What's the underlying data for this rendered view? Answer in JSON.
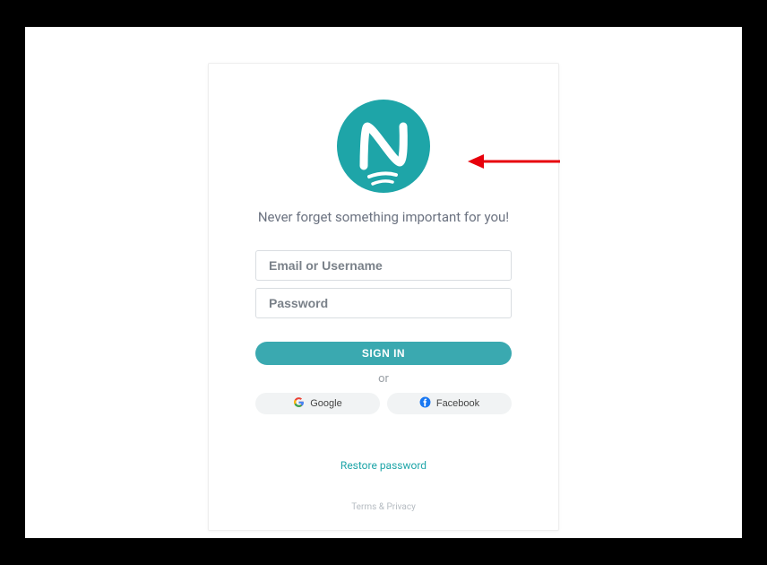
{
  "brand": {
    "tagline": "Never forget something important for you!"
  },
  "form": {
    "email_placeholder": "Email or Username",
    "password_placeholder": "Password",
    "signin_label": "SIGN IN"
  },
  "divider": {
    "text": "or"
  },
  "social": {
    "google_label": "Google",
    "facebook_label": "Facebook"
  },
  "links": {
    "restore": "Restore password",
    "legal": "Terms & Privacy"
  },
  "colors": {
    "accent": "#1ea5a8"
  }
}
